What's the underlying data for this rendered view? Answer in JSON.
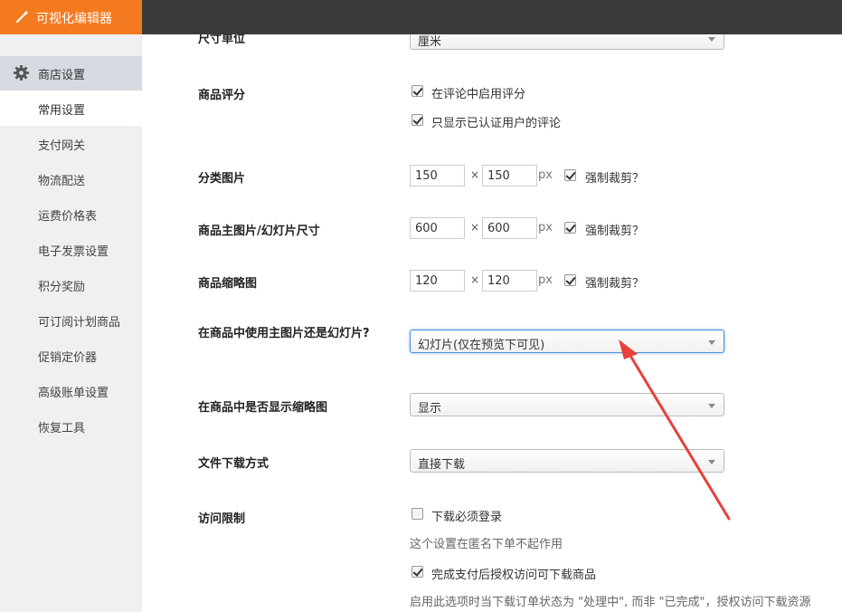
{
  "app": {
    "title": "可视化编辑器",
    "icon": "magic-wand-icon"
  },
  "sidebar": {
    "section": {
      "label": "商店设置",
      "icon": "gear-icon"
    },
    "items": [
      {
        "label": "常用设置",
        "active": true
      },
      {
        "label": "支付网关"
      },
      {
        "label": "物流配送"
      },
      {
        "label": "运费价格表"
      },
      {
        "label": "电子发票设置"
      },
      {
        "label": "积分奖励"
      },
      {
        "label": "可订阅计划商品"
      },
      {
        "label": "促销定价器"
      },
      {
        "label": "高级账单设置"
      },
      {
        "label": "恢复工具"
      }
    ]
  },
  "form": {
    "size_unit": {
      "label": "尺寸单位",
      "value": "厘米"
    },
    "rating": {
      "label": "商品评分",
      "opt1": "在评论中启用评分",
      "opt2": "只显示已认证用户的评论"
    },
    "category_image": {
      "label": "分类图片",
      "width": "150",
      "height": "150",
      "unit": "px",
      "crop": "强制裁剪？"
    },
    "main_image": {
      "label": "商品主图片/幻灯片尺寸",
      "width": "600",
      "height": "600",
      "unit": "px",
      "crop": "强制裁剪？"
    },
    "thumbnail": {
      "label": "商品缩略图",
      "width": "120",
      "height": "120",
      "unit": "px",
      "crop": "强制裁剪？"
    },
    "times": "×",
    "main_or_slide": {
      "label": "在商品中使用主图片还是幻灯片?",
      "value": "幻灯片(仅在预览下可见)"
    },
    "show_thumbs": {
      "label": "在商品中是否显示缩略图",
      "value": "显示"
    },
    "download_method": {
      "label": "文件下载方式",
      "value": "直接下载"
    },
    "access": {
      "label": "访问限制",
      "opt1": "下载必须登录",
      "opt1_help": "这个设置在匿名下单不起作用",
      "opt2": "完成支付后授权访问可下载商品",
      "opt2_help": "启用此选项时当下载订单状态为 \"处理中\", 而非 \"已完成\"，授权访问下载资源"
    }
  },
  "colors": {
    "brand": "#f47a20",
    "topbar": "#3a3a3a",
    "annotation_arrow": "#e8403a"
  }
}
